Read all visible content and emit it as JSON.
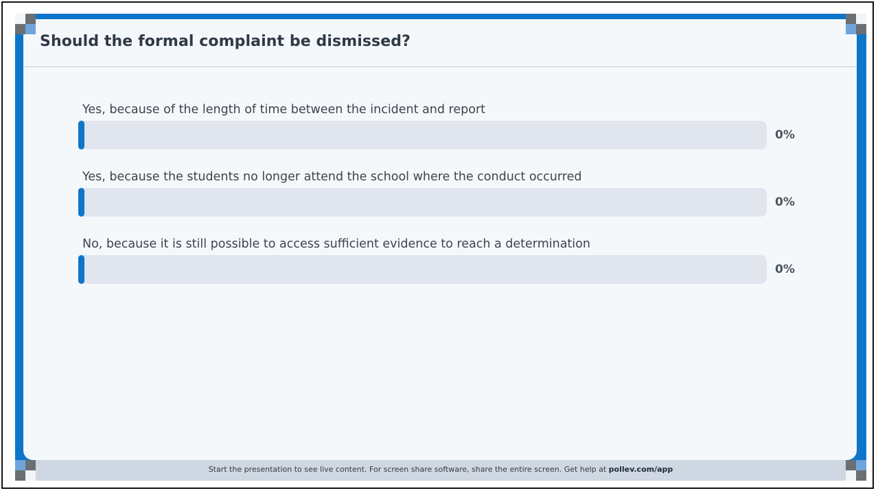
{
  "poll": {
    "question": "Should the formal complaint be dismissed?",
    "options": [
      {
        "label": "Yes, because of the length of time between the incident and report",
        "percent_text": "0%",
        "fraction": 0
      },
      {
        "label": "Yes, because the students no longer attend the school where the conduct occurred",
        "percent_text": "0%",
        "fraction": 0
      },
      {
        "label": "No, because it is still possible to access sufficient evidence to reach a determination",
        "percent_text": "0%",
        "fraction": 0
      }
    ]
  },
  "footer": {
    "text": "Start the presentation to see live content. For screen share software, share the entire screen. Get help at ",
    "link": "pollev.com/app"
  },
  "colors": {
    "accent": "#0f75c9",
    "track": "#e1e6ee",
    "panel": "#f5f8fb",
    "footer_bg": "#cfd7e2"
  },
  "icons": {
    "corner_markers": "corner-marker-icon"
  }
}
